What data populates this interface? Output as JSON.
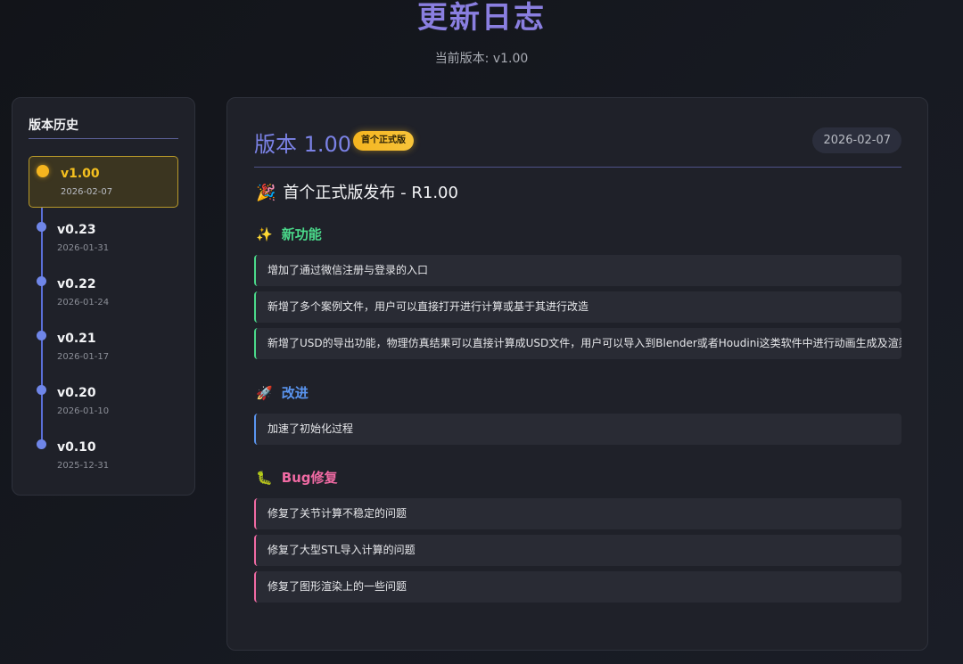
{
  "page": {
    "title": "更新日志",
    "subtitle": "当前版本: v1.00"
  },
  "sidebar": {
    "title": "版本历史",
    "versions": [
      {
        "label": "v1.00",
        "date": "2026-02-07",
        "active": true
      },
      {
        "label": "v0.23",
        "date": "2026-01-31"
      },
      {
        "label": "v0.22",
        "date": "2026-01-24"
      },
      {
        "label": "v0.21",
        "date": "2026-01-17"
      },
      {
        "label": "v0.20",
        "date": "2026-01-10"
      },
      {
        "label": "v0.10",
        "date": "2025-12-31"
      }
    ]
  },
  "release": {
    "title": "版本 1.00",
    "badge": "首个正式版",
    "date": "2026-02-07",
    "headline_icon": "🎉",
    "headline": "首个正式版发布 - R1.00",
    "sections": [
      {
        "icon": "✨",
        "icon_name": "sparkles-icon",
        "title": "新功能",
        "color": "#4ad98a",
        "items": [
          "增加了通过微信注册与登录的入口",
          "新增了多个案例文件，用户可以直接打开进行计算或基于其进行改造",
          "新增了USD的导出功能，物理仿真结果可以直接计算成USD文件，用户可以导入到Blender或者Houdini这类软件中进行动画生成及渲染"
        ]
      },
      {
        "icon": "🚀",
        "icon_name": "rocket-icon",
        "title": "改进",
        "color": "#5a95f0",
        "items": [
          "加速了初始化过程"
        ]
      },
      {
        "icon": "🐛",
        "icon_name": "bug-icon",
        "title": "Bug修复",
        "color": "#f06aa3",
        "items": [
          "修复了关节计算不稳定的问题",
          "修复了大型STL导入计算的问题",
          "修复了图形渲染上的一些问题"
        ]
      }
    ]
  },
  "colors": {
    "accent": "#8a7fe0",
    "active": "#f5b51f",
    "timeline": "#6f86e8"
  }
}
